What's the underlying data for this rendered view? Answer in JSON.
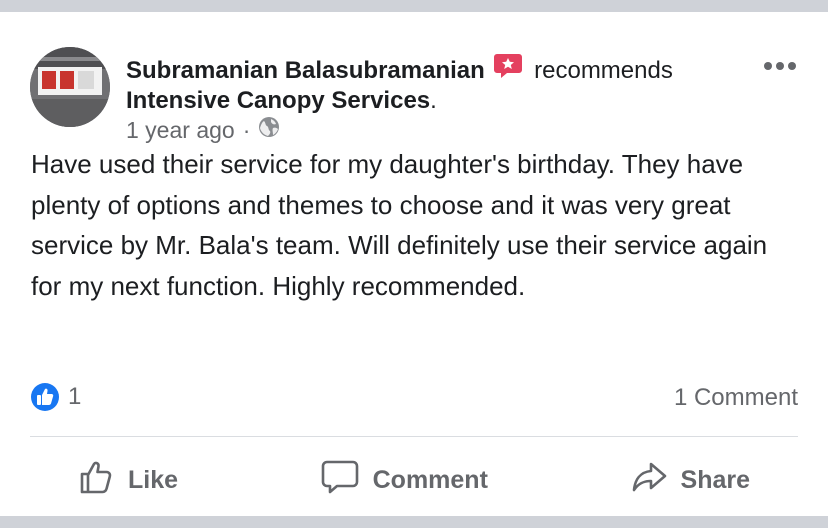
{
  "post": {
    "author": "Subramanian Balasubramanian",
    "verb": "recommends",
    "page": "Intensive Canopy Services",
    "page_suffix": ".",
    "time": "1 year ago",
    "separator": "·",
    "privacy_icon": "globe-icon",
    "text": "Have used their service for my daughter's birthday. They have plenty of options and themes to choose and it was very great service by Mr. Bala's team. Will definitely use their service again for my next function. Highly recommended."
  },
  "stats": {
    "reaction_count": "1",
    "comments": "1 Comment"
  },
  "actions": {
    "like": "Like",
    "comment": "Comment",
    "share": "Share"
  },
  "colors": {
    "recommend_red": "#e4405f",
    "like_blue": "#1877f2",
    "muted": "#65676b",
    "text": "#1c1e21"
  }
}
